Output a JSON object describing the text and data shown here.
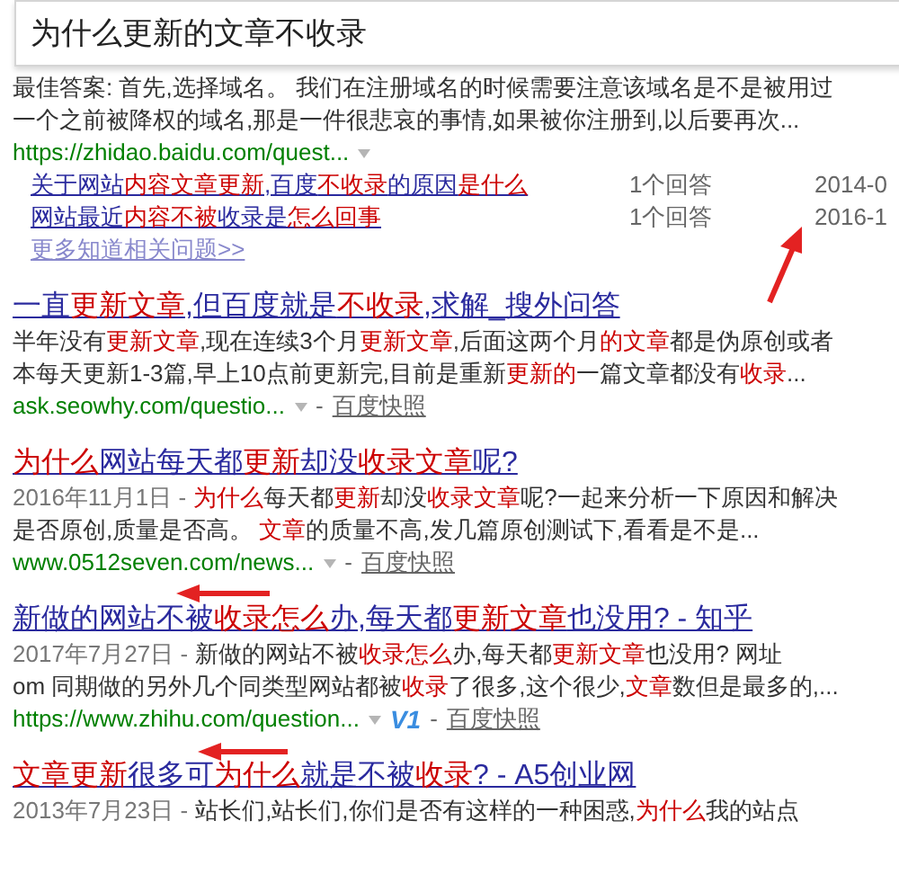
{
  "search": {
    "value": "为什么更新的文章不收录"
  },
  "top_answer": {
    "lines": [
      [
        "最佳答案: 首先,选择域名。 我们在注册域名的时候需要注意该域名是不是被用过"
      ],
      [
        "一个之前被降权的域名,那是一件很悲哀的事情,如果被你注册到,以后要再次..."
      ]
    ],
    "url": "https://zhidao.baidu.com/quest...",
    "questions": [
      {
        "title": [
          "关于网站",
          {
            "em": "内容文章更新"
          },
          ",百度",
          {
            "em": "不收录"
          },
          "的原因",
          {
            "em": "是什么"
          }
        ],
        "answers": "1个回答",
        "date": "2014-0"
      },
      {
        "title": [
          "网站最近",
          {
            "em": "内容不被"
          },
          "收录是",
          {
            "em": "怎么回事"
          }
        ],
        "answers": "1个回答",
        "date": "2016-1"
      }
    ],
    "more": "更多知道相关问题>>"
  },
  "results": [
    {
      "title": [
        "一直",
        {
          "em": "更新文章"
        },
        ",但百度就是",
        {
          "em": "不收录"
        },
        ",求解_搜外问答"
      ],
      "lines": [
        [
          "半年没有",
          {
            "em": "更新文章"
          },
          ",现在连续3个月",
          {
            "em": "更新文章"
          },
          ",后面这两个月",
          {
            "em": "的文章"
          },
          "都是伪原创或者"
        ],
        [
          "本每天更新1-3篇,早上10点前更新完,目前是重新",
          {
            "em": "更新的"
          },
          "一篇文章都没有",
          {
            "em": "收录"
          },
          "..."
        ]
      ],
      "url": "ask.seowhy.com/questio...",
      "separator": "-",
      "snapshot": "百度快照"
    },
    {
      "title": [
        {
          "em": "为什么"
        },
        "网站每天都",
        {
          "em": "更新"
        },
        "却没",
        {
          "em": "收录文章"
        },
        "呢?"
      ],
      "date": "2016年11月1日 -",
      "lines": [
        [
          {
            "em": "为什么"
          },
          "每天都",
          {
            "em": "更新"
          },
          "却没",
          {
            "em": "收录文章"
          },
          "呢?一起来分析一下原因和解决"
        ],
        [
          "是否原创,质量是否高。 ",
          {
            "em": "文章"
          },
          "的质量不高,发几篇原创测试下,看看是不是..."
        ]
      ],
      "url": "www.0512seven.com/news...",
      "separator": "-",
      "snapshot": "百度快照"
    },
    {
      "title": [
        "新做的网站不被",
        {
          "em": "收录怎么"
        },
        "办,每天都",
        {
          "em": "更新文章"
        },
        "也没用? - 知乎"
      ],
      "date": "2017年7月27日 -",
      "lines": [
        [
          "新做的网站不被",
          {
            "em": "收录怎么"
          },
          "办,每天都",
          {
            "em": "更新文章"
          },
          "也没用? 网址"
        ],
        [
          "om 同期做的另外几个同类型网站都被",
          {
            "em": "收录"
          },
          "了很多,这个很少,",
          {
            "em": "文章"
          },
          "数但是最多的,..."
        ]
      ],
      "url": "https://www.zhihu.com/question...",
      "badge": "V1",
      "separator": "-",
      "snapshot": "百度快照"
    },
    {
      "title": [
        {
          "em": "文章更新"
        },
        "很多可",
        {
          "em": "为什么"
        },
        "就是不被",
        {
          "em": "收录"
        },
        "? - A5创业网"
      ],
      "date": "2013年7月23日 -",
      "lines": [
        [
          "站长们,站长们,你们是否有这样的一种困惑,",
          {
            "em": "为什么"
          },
          "我的站点"
        ]
      ]
    }
  ]
}
